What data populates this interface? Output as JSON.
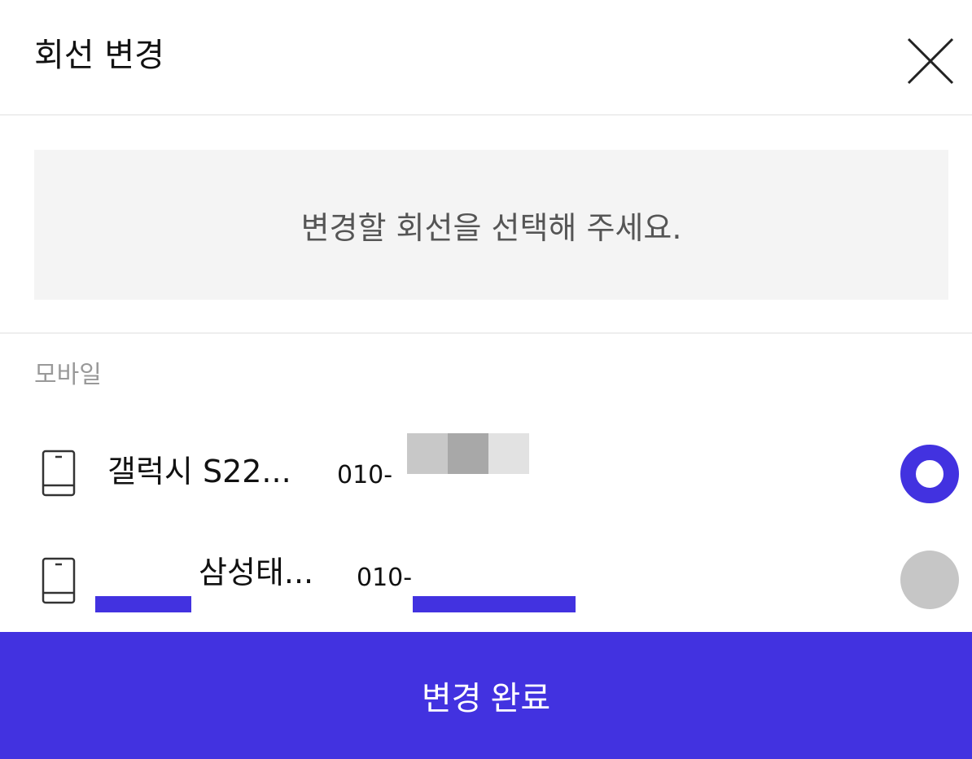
{
  "header": {
    "title": "회선 변경",
    "close_icon": "close-icon"
  },
  "notice": {
    "text": "변경할 회선을 선택해 주세요."
  },
  "section": {
    "label": "모바일"
  },
  "lines": [
    {
      "device": "갤럭시 S22...",
      "number_prefix": "010-",
      "selected": true,
      "icon": "phone-icon"
    },
    {
      "device": "삼성태...",
      "number_prefix": "010-",
      "selected": false,
      "icon": "phone-icon"
    }
  ],
  "footer": {
    "confirm_label": "변경 완료"
  },
  "colors": {
    "accent": "#4232e0",
    "unselected_radio": "#c6c6c6",
    "notice_bg": "#f4f4f4"
  }
}
